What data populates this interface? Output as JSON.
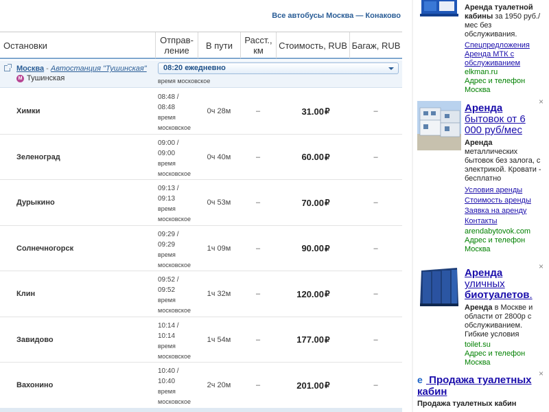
{
  "header": {
    "all_buses_link": "Все автобусы Москва — Конаково"
  },
  "table": {
    "columns": [
      "Остановки",
      "Отправ-\nление",
      "В пути",
      "Расст.,\nкм",
      "Стоимость, RUB",
      "Багаж, RUB"
    ],
    "origin": {
      "city": "Москва",
      "separator": " - ",
      "station": "Автостанция \"Тушинская\"",
      "metro": "Тушинская",
      "metro_letter": "М",
      "departure_select": "08:20 ежедневно",
      "timezone": "время московское"
    },
    "rows": [
      {
        "stop": "Химки",
        "time": "08:48 /\n08:48",
        "tz": "время\nмосковское",
        "duration": "0ч 28м",
        "distance": "–",
        "price": "31.00",
        "currency": "₽",
        "baggage": "–"
      },
      {
        "stop": "Зеленоград",
        "time": "09:00 /\n09:00",
        "tz": "время\nмосковское",
        "duration": "0ч 40м",
        "distance": "–",
        "price": "60.00",
        "currency": "₽",
        "baggage": "–"
      },
      {
        "stop": "Дурыкино",
        "time": "09:13 /\n09:13",
        "tz": "время\nмосковское",
        "duration": "0ч 53м",
        "distance": "–",
        "price": "70.00",
        "currency": "₽",
        "baggage": "–"
      },
      {
        "stop": "Солнечногорск",
        "time": "09:29 /\n09:29",
        "tz": "время\nмосковское",
        "duration": "1ч 09м",
        "distance": "–",
        "price": "90.00",
        "currency": "₽",
        "baggage": "–"
      },
      {
        "stop": "Клин",
        "time": "09:52 /\n09:52",
        "tz": "время\nмосковское",
        "duration": "1ч 32м",
        "distance": "–",
        "price": "120.00",
        "currency": "₽",
        "baggage": "–"
      },
      {
        "stop": "Завидово",
        "time": "10:14 /\n10:14",
        "tz": "время\nмосковское",
        "duration": "1ч 54м",
        "distance": "–",
        "price": "177.00",
        "currency": "₽",
        "baggage": "–"
      },
      {
        "stop": "Вахонино",
        "time": "10:40 /\n10:40",
        "tz": "время\nмосковское",
        "duration": "2ч 20м",
        "distance": "–",
        "price": "201.00",
        "currency": "₽",
        "baggage": "–"
      }
    ]
  },
  "ads": {
    "close_glyph": "×",
    "ad1": {
      "desc_bold": "Аренда туалетной кабины",
      "desc": " за 1950 руб./мес без обслуживания.",
      "links": [
        "Спецпредложения",
        "Аренда МТК с обслуживанием"
      ],
      "domain": "elkman.ru",
      "address": "Адрес и телефон",
      "city": "Москва"
    },
    "ad2": {
      "title_bold": "Аренда",
      "title_rest": "бытовок от 6 000 руб/мес",
      "desc_bold": "Аренда",
      "desc": " металлических бытовок без залога, с электрикой. Кровати - бесплатно",
      "links": [
        "Условия аренды",
        "Стоимость аренды",
        "Заявка на аренду",
        "Контакты"
      ],
      "domain": "arendabytovok.com",
      "address": "Адрес и телефон",
      "city": "Москва"
    },
    "ad3": {
      "title_bold": "Аренда",
      "title_rest": "уличных",
      "title_bold2": "биотуалетов",
      "title_end": ".",
      "desc_bold": "Аренда",
      "desc": " в Москве и области от 2800р с обслуживанием. Гибкие условия",
      "domain": "toilet.su",
      "address": "Адрес и телефон",
      "city": "Москва"
    },
    "ad4": {
      "title": "Продажа туалетных кабин",
      "desc": "Продажа туалетных кабин"
    }
  }
}
